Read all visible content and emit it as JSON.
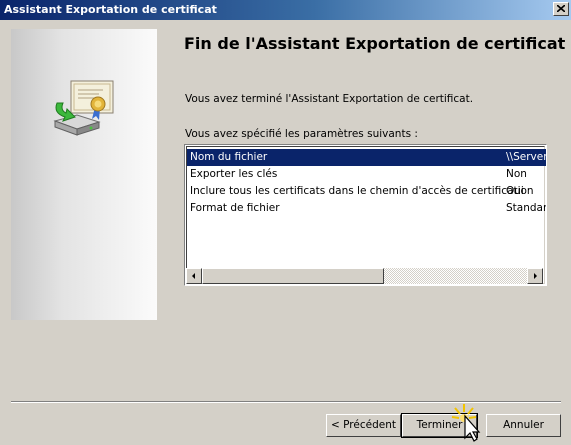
{
  "window": {
    "title": "Assistant Exportation de certificat"
  },
  "main": {
    "heading": "Fin de l'Assistant Exportation de certificat",
    "completed_text": "Vous avez terminé l'Assistant Exportation de certificat.",
    "specified_label": "Vous avez spécifié les paramètres suivants :"
  },
  "settings_list": {
    "rows": [
      {
        "name": "Nom du fichier",
        "value": "\\\\Server",
        "selected": true
      },
      {
        "name": "Exporter les clés",
        "value": "Non",
        "selected": false
      },
      {
        "name": "Inclure tous les certificats dans le chemin d'accès de certification",
        "value": "Oui",
        "selected": false
      },
      {
        "name": "Format de fichier",
        "value": "Standar",
        "selected": false
      }
    ]
  },
  "buttons": {
    "previous": "< Précédent",
    "finish": "Terminer",
    "cancel": "Annuler"
  },
  "icons": {
    "close": "close-icon",
    "wizard": "certificate-export-icon",
    "cursor": "mouse-pointer-icon"
  },
  "colors": {
    "titlebar_start": "#0a246a",
    "titlebar_end": "#a6caf0",
    "selection": "#0a246a",
    "window_bg": "#d4d0c8"
  }
}
